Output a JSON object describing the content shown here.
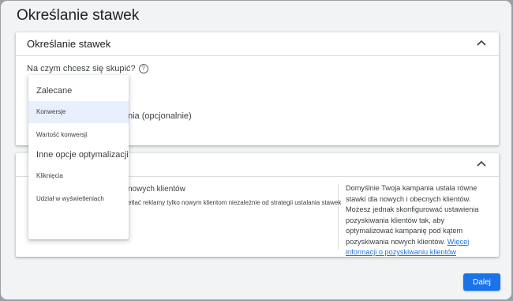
{
  "dialog": {
    "title": "Określanie stawek"
  },
  "bidding_card": {
    "title": "Określanie stawek",
    "question": "Na czym chcesz się skupić?",
    "help_icon": "?",
    "partial_option_text": "nia (opcjonalnie)"
  },
  "customer_card": {
    "partial_title": "nowych klientów",
    "partial_description": "etlać reklamy tylko nowym klientom niezależnie od strategii ustalania stawek",
    "info_text": "Domyślnie Twoja kampania ustala równe stawki dla nowych i obecnych klientów. Możesz jednak skonfigurować ustawienia pozyskiwania klientów tak, aby optymalizować kampanię pod kątem pozyskiwania nowych klientów.",
    "info_link": "Więcej informacji o pozyskiwaniu klientów"
  },
  "dropdown": {
    "heading_recommended": "Zalecane",
    "items_recommended": [
      "Konwersje",
      "Wartość konwersji"
    ],
    "heading_other": "Inne opcje optymalizacji",
    "items_other": [
      "Kliknięcia",
      "Udział w wyświetleniach"
    ],
    "selected": "Konwersje"
  },
  "footer": {
    "next_label": "Dalej"
  },
  "colors": {
    "primary": "#1a73e8",
    "selected_bg": "#e8f0fe",
    "dialog_bg": "#f1f3f4"
  },
  "icons": {
    "collapse": "chevron-up-icon",
    "help": "help-icon"
  }
}
